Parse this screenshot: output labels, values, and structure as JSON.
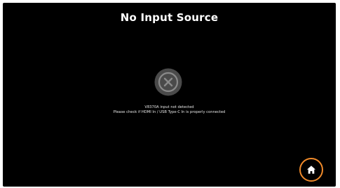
{
  "title": "No Input Source",
  "error": {
    "icon": "close-circle-icon",
    "line1": "V8370A input not detected",
    "line2": "Please check if HDMI In / USB Type-C In is properly connected"
  },
  "home_button": {
    "icon": "home-icon",
    "accent_color": "#f08a2a"
  },
  "colors": {
    "background": "#000000",
    "icon_gray": "#6e6e6e",
    "text": "#ffffff"
  }
}
